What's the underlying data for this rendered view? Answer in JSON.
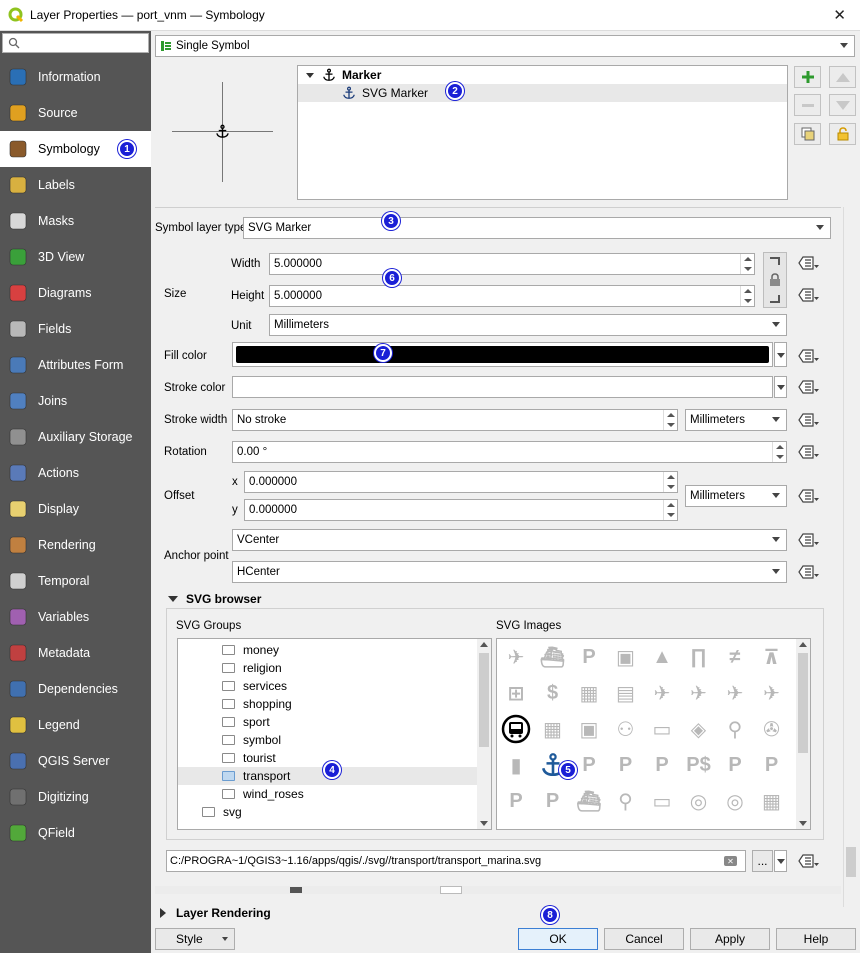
{
  "window": {
    "title": "Layer Properties — port_vnm — Symbology"
  },
  "sidebar": {
    "search_placeholder": "",
    "items": [
      {
        "label": "Information",
        "icon": "info-icon"
      },
      {
        "label": "Source",
        "icon": "source-icon"
      },
      {
        "label": "Symbology",
        "icon": "symbology-icon"
      },
      {
        "label": "Labels",
        "icon": "labels-icon"
      },
      {
        "label": "Masks",
        "icon": "masks-icon"
      },
      {
        "label": "3D View",
        "icon": "3d-view-icon"
      },
      {
        "label": "Diagrams",
        "icon": "diagrams-icon"
      },
      {
        "label": "Fields",
        "icon": "fields-icon"
      },
      {
        "label": "Attributes Form",
        "icon": "attributes-form-icon"
      },
      {
        "label": "Joins",
        "icon": "joins-icon"
      },
      {
        "label": "Auxiliary Storage",
        "icon": "auxiliary-storage-icon"
      },
      {
        "label": "Actions",
        "icon": "actions-icon"
      },
      {
        "label": "Display",
        "icon": "display-icon"
      },
      {
        "label": "Rendering",
        "icon": "rendering-icon"
      },
      {
        "label": "Temporal",
        "icon": "temporal-icon"
      },
      {
        "label": "Variables",
        "icon": "variables-icon"
      },
      {
        "label": "Metadata",
        "icon": "metadata-icon"
      },
      {
        "label": "Dependencies",
        "icon": "dependencies-icon"
      },
      {
        "label": "Legend",
        "icon": "legend-icon"
      },
      {
        "label": "QGIS Server",
        "icon": "qgis-server-icon"
      },
      {
        "label": "Digitizing",
        "icon": "digitizing-icon"
      },
      {
        "label": "QField",
        "icon": "qfield-icon"
      }
    ]
  },
  "renderer": {
    "value": "Single Symbol"
  },
  "symbol_tree": {
    "root": "Marker",
    "child": "SVG Marker"
  },
  "form": {
    "symbol_layer_type_label": "Symbol layer type",
    "symbol_layer_type": "SVG Marker",
    "size_label": "Size",
    "width_label": "Width",
    "width": "5.000000",
    "height_label": "Height",
    "height": "5.000000",
    "unit_label": "Unit",
    "unit": "Millimeters",
    "fill_color_label": "Fill color",
    "fill_color": "#000000",
    "stroke_color_label": "Stroke color",
    "stroke_color": "#ffffff",
    "stroke_width_label": "Stroke width",
    "stroke_width": "No stroke",
    "stroke_unit": "Millimeters",
    "rotation_label": "Rotation",
    "rotation": "0.00 °",
    "offset_label": "Offset",
    "x_label": "x",
    "offset_x": "0.000000",
    "y_label": "y",
    "offset_y": "0.000000",
    "offset_unit": "Millimeters",
    "anchor_label": "Anchor point",
    "anchor_v": "VCenter",
    "anchor_h": "HCenter"
  },
  "svg_browser": {
    "title": "SVG browser",
    "groups_label": "SVG Groups",
    "images_label": "SVG Images",
    "groups": [
      "money",
      "religion",
      "services",
      "shopping",
      "sport",
      "symbol",
      "tourist",
      "transport",
      "wind_roses"
    ],
    "root_group": "svg",
    "selected_group": "transport",
    "path": "C:/PROGRA~1/QGIS3~1.16/apps/qgis/./svg//transport/transport_marina.svg",
    "browse_label": "..."
  },
  "layer_rendering": {
    "title": "Layer Rendering"
  },
  "buttons": {
    "style": "Style",
    "ok": "OK",
    "cancel": "Cancel",
    "apply": "Apply",
    "help": "Help"
  },
  "badges": [
    "1",
    "2",
    "3",
    "4",
    "5",
    "6",
    "7",
    "8"
  ],
  "colors": {
    "badge": "#1a1fd6",
    "sidebar": "#555555",
    "accent_green": "#2e9a2e"
  }
}
